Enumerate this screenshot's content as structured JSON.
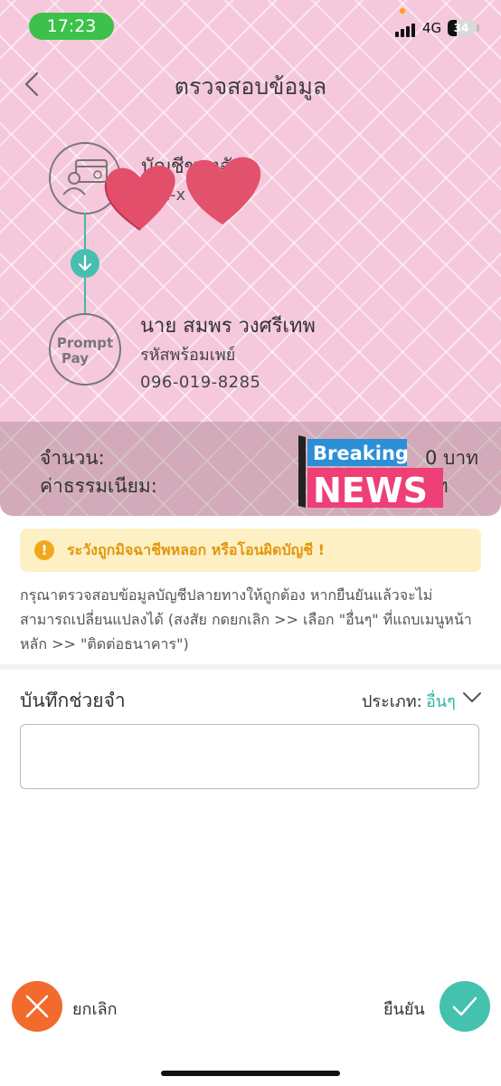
{
  "status": {
    "time": "17:23",
    "network": "4G",
    "battery_percent": "34",
    "battery_level": 0.34
  },
  "header": {
    "title": "ตรวจสอบข้อมูล"
  },
  "source": {
    "title": "บัญชีของฉัน",
    "account_masked": "xxx-x"
  },
  "recipient": {
    "name": "นาย สมพร วงศรีเทพ",
    "type": "รหัสพร้อมเพย์",
    "phone": "096-019-8285",
    "logo_line1": "Prompt",
    "logo_line2": "Pay"
  },
  "summary": {
    "amount_label": "จำนวน:",
    "fee_label": "ค่าธรรมเนียม:",
    "amount_unit": "0 บาท",
    "fee_unit": "าท"
  },
  "sticker": {
    "line1": "Breaking",
    "line2": "NEWS"
  },
  "warning": {
    "text": "ระวังถูกมิจฉาชีพหลอก หรือโอนผิดบัญชี !"
  },
  "info": {
    "text": "กรุณาตรวจสอบข้อมูลบัญชีปลายทางให้ถูกต้อง หากยืนยันแล้วจะไม่สามารถเปลี่ยนแปลงได้ (สงสัย กดยกเลิก >> เลือก \"อื่นๆ\" ที่แถบเมนูหน้าหลัก >> \"ติดต่อธนาคาร\")"
  },
  "memo": {
    "label": "บันทึกช่วยจำ",
    "type_label": "ประเภท:",
    "type_value": "อื่นๆ",
    "value": ""
  },
  "actions": {
    "cancel_label": "ยกเลิก",
    "confirm_label": "ยืนยัน"
  },
  "colors": {
    "accent": "#45c1b0",
    "cancel": "#f26a2c",
    "warning": "#e4960c",
    "header_bg": "#f6c8dc"
  }
}
